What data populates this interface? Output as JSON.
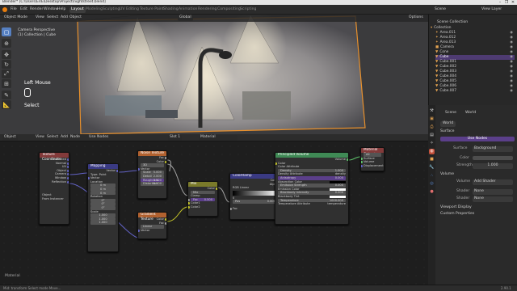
{
  "title_bar": {
    "text": "Blender* [C:\\Users\\EVE\\Desktop\\Project\\nightstreet.blend]",
    "controls": [
      "–",
      "❐",
      "✕"
    ]
  },
  "menus": [
    "File",
    "Edit",
    "Render",
    "Window",
    "Help"
  ],
  "workspaces": [
    "Layout",
    "Modeling",
    "Sculpting",
    "UV Editing",
    "Texture Paint",
    "Shading",
    "Animation",
    "Rendering",
    "Compositing",
    "Scripting"
  ],
  "active_workspace": "Layout",
  "scene": "Scene",
  "view_layer": "View Layer",
  "viewport": {
    "mode": "Object Mode",
    "menus": [
      "View",
      "Select",
      "Add",
      "Object"
    ],
    "transform": "Global",
    "camera_label": "Camera Perspective",
    "collection_label": "(1) Collection | Cube",
    "overlay_text": {
      "mouse_top": "Left Mouse",
      "mouse_bottom": "Select"
    },
    "options": "Options"
  },
  "outliner": {
    "title": "Scene Collection",
    "rows": [
      {
        "name": "Collection",
        "icon": "▾",
        "sel": false
      },
      {
        "name": "Area.011",
        "icon": "✦",
        "sel": false
      },
      {
        "name": "Area.012",
        "icon": "✦",
        "sel": false
      },
      {
        "name": "Area.013",
        "icon": "✦",
        "sel": false
      },
      {
        "name": "Camera",
        "icon": "■",
        "sel": false
      },
      {
        "name": "Cone",
        "icon": "▼",
        "sel": false
      },
      {
        "name": "Cube",
        "icon": "▼",
        "sel": true
      },
      {
        "name": "Cube.001",
        "icon": "▼",
        "sel": false
      },
      {
        "name": "Cube.002",
        "icon": "▼",
        "sel": false
      },
      {
        "name": "Cube.003",
        "icon": "▼",
        "sel": false
      },
      {
        "name": "Cube.004",
        "icon": "▼",
        "sel": false
      },
      {
        "name": "Cube.005",
        "icon": "▼",
        "sel": false
      },
      {
        "name": "Cube.006",
        "icon": "▼",
        "sel": false
      },
      {
        "name": "Cube.007",
        "icon": "▼",
        "sel": false
      }
    ]
  },
  "properties": {
    "scene": "Scene",
    "world_tab": "World",
    "world_name": "World",
    "surface_header": "Surface",
    "use_nodes": "Use Nodes",
    "surface_label": "Surface",
    "surface_value": "Background",
    "color_label": "Color",
    "strength_label": "Strength",
    "strength_value": "1.000",
    "volume_header": "Volume",
    "volume_label": "Volume",
    "volume_value": "Add Shader",
    "shader1_label": "Shader",
    "shader1_value": "None",
    "shader2_label": "Shader",
    "shader2_value": "None",
    "viewport_display": "Viewport Display",
    "custom_props": "Custom Properties"
  },
  "node_editor": {
    "type": "Object",
    "menus": [
      "View",
      "Select",
      "Add",
      "Node"
    ],
    "use_nodes": "Use Nodes",
    "slot": "Slot 1",
    "material": "Material",
    "footer_material": "Material",
    "nodes": {
      "texcoord": {
        "title": "Texture Coordinate",
        "outputs": [
          "Generated",
          "Normal",
          "UV",
          "Object",
          "Camera",
          "Window",
          "Reflection"
        ],
        "object_label": "Object",
        "from_instancer": "From Instancer"
      },
      "mapping": {
        "title": "Mapping",
        "out": "Vector",
        "type_label": "Type:",
        "type": "Point",
        "vector": "Vector",
        "location": "Location",
        "loc": [
          "0 m",
          "0 m",
          "0 m"
        ],
        "rotation": "Rotation",
        "rot": [
          "0°",
          "0°",
          "0°"
        ],
        "scale": "Scale",
        "scl": [
          "1.000",
          "1.000",
          "1.000"
        ]
      },
      "noise": {
        "title": "Noise Texture",
        "outputs": [
          "Fac",
          "Color"
        ],
        "dim": "3D",
        "vector": "Vector",
        "scale": "Scale",
        "scale_v": "5.000",
        "detail": "Detail",
        "detail_v": "2.000",
        "roughness": "Roughness",
        "roughness_v": "0.500",
        "distortion": "Distortion",
        "distortion_v": "0.000"
      },
      "gradient": {
        "title": "Gradient Texture",
        "outputs": [
          "Color",
          "Fac"
        ],
        "type": "Linear",
        "vector": "Vector"
      },
      "mix": {
        "title": "Mix",
        "out": "Color",
        "blend": "Mix",
        "clamp": "Clamp",
        "fac": "Fac",
        "fac_v": "0.500",
        "color1": "Color1",
        "color2": "Color2"
      },
      "ramp": {
        "title": "ColorRamp",
        "outputs": [
          "Color",
          "Alpha"
        ],
        "mode": "RGB",
        "interp": "Linear",
        "pos": "Pos",
        "pos_v": "0.000",
        "index": "0",
        "fac": "Fac"
      },
      "volume": {
        "title": "Principled Volume",
        "out": "Volume",
        "fields": [
          "Color",
          "Color Attribute",
          "Density",
          "Density Attribute",
          "Anisotropy",
          "Absorption Color",
          "Emission Strength",
          "Emission Color",
          "Blackbody Intensity",
          "Blackbody Tint",
          "Temperature",
          "Temperature Attribute"
        ],
        "values": [
          "",
          "",
          "1.000",
          "density",
          "0.000",
          "",
          "0.000",
          "",
          "0.000",
          "",
          "1000.000",
          "temperature"
        ]
      },
      "output": {
        "title": "Material Output",
        "target": "All",
        "inputs": [
          "Surface",
          "Volume",
          "Displacement"
        ]
      }
    }
  },
  "status": {
    "left": "Mid: transform  Select mode  Move...",
    "right": "2.90.1"
  }
}
